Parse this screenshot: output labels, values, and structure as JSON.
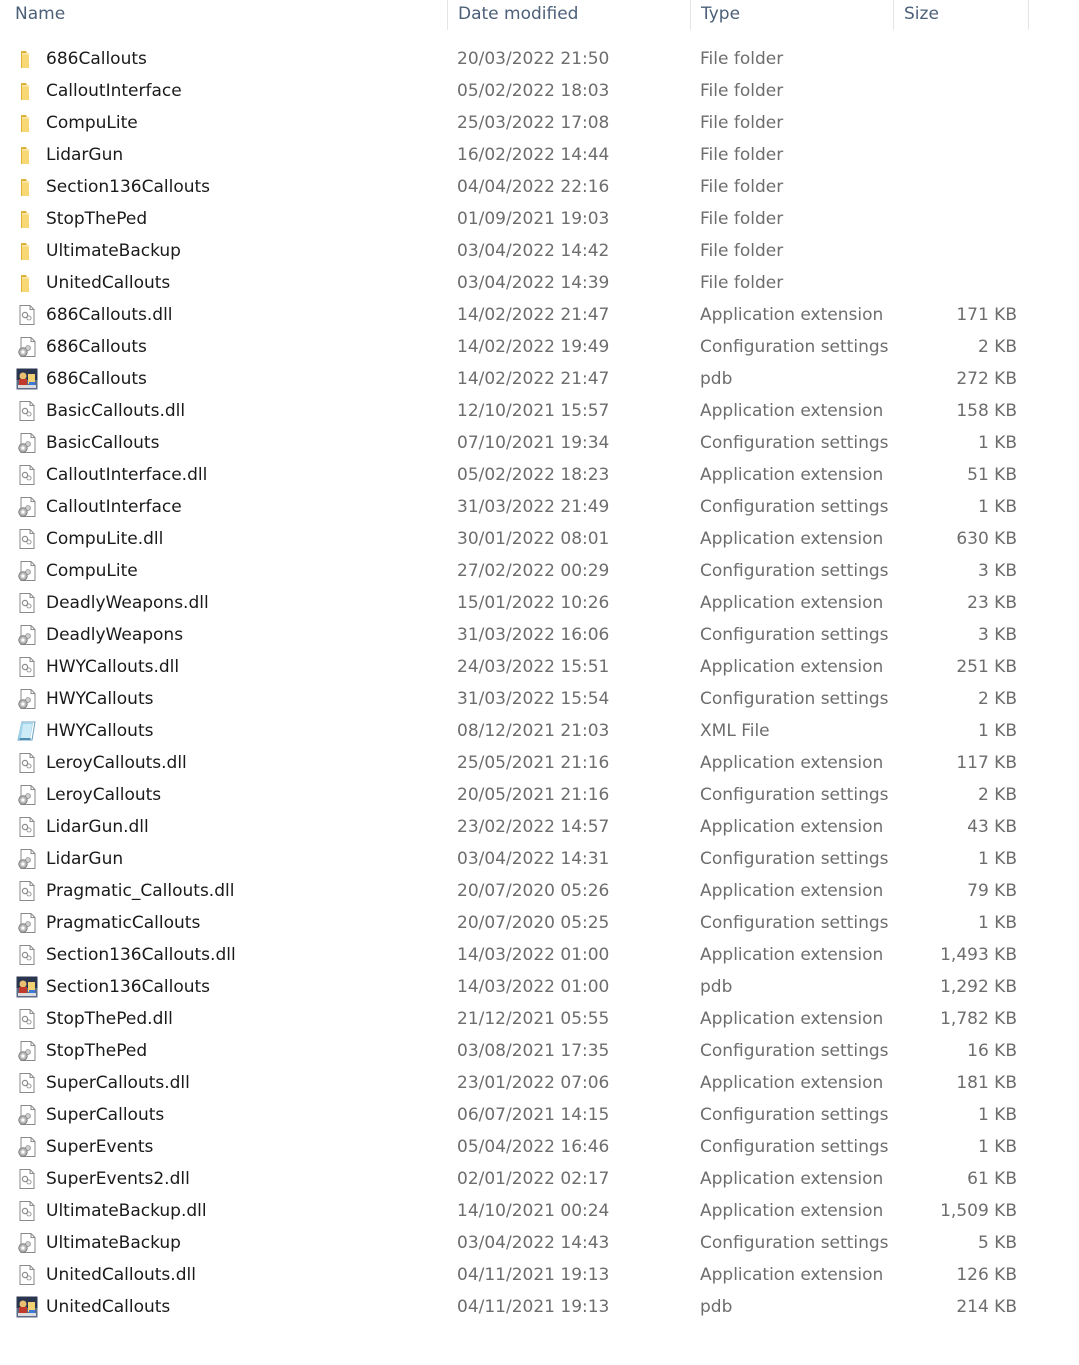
{
  "columns": {
    "name": "Name",
    "date": "Date modified",
    "type": "Type",
    "size": "Size"
  },
  "files": [
    {
      "name": "686Callouts",
      "date": "20/03/2022 21:50",
      "type": "File folder",
      "size": "",
      "icon": "folder-icon"
    },
    {
      "name": "CalloutInterface",
      "date": "05/02/2022 18:03",
      "type": "File folder",
      "size": "",
      "icon": "folder-icon"
    },
    {
      "name": "CompuLite",
      "date": "25/03/2022 17:08",
      "type": "File folder",
      "size": "",
      "icon": "folder-icon"
    },
    {
      "name": "LidarGun",
      "date": "16/02/2022 14:44",
      "type": "File folder",
      "size": "",
      "icon": "folder-icon"
    },
    {
      "name": "Section136Callouts",
      "date": "04/04/2022 22:16",
      "type": "File folder",
      "size": "",
      "icon": "folder-icon"
    },
    {
      "name": "StopThePed",
      "date": "01/09/2021 19:03",
      "type": "File folder",
      "size": "",
      "icon": "folder-icon"
    },
    {
      "name": "UltimateBackup",
      "date": "03/04/2022 14:42",
      "type": "File folder",
      "size": "",
      "icon": "folder-icon"
    },
    {
      "name": "UnitedCallouts",
      "date": "03/04/2022 14:39",
      "type": "File folder",
      "size": "",
      "icon": "folder-icon"
    },
    {
      "name": "686Callouts.dll",
      "date": "14/02/2022 21:47",
      "type": "Application extension",
      "size": "171 KB",
      "icon": "dll-icon"
    },
    {
      "name": "686Callouts",
      "date": "14/02/2022 19:49",
      "type": "Configuration settings",
      "size": "2 KB",
      "icon": "config-icon"
    },
    {
      "name": "686Callouts",
      "date": "14/02/2022 21:47",
      "type": "pdb",
      "size": "272 KB",
      "icon": "pdb-icon"
    },
    {
      "name": "BasicCallouts.dll",
      "date": "12/10/2021 15:57",
      "type": "Application extension",
      "size": "158 KB",
      "icon": "dll-icon"
    },
    {
      "name": "BasicCallouts",
      "date": "07/10/2021 19:34",
      "type": "Configuration settings",
      "size": "1 KB",
      "icon": "config-icon"
    },
    {
      "name": "CalloutInterface.dll",
      "date": "05/02/2022 18:23",
      "type": "Application extension",
      "size": "51 KB",
      "icon": "dll-icon"
    },
    {
      "name": "CalloutInterface",
      "date": "31/03/2022 21:49",
      "type": "Configuration settings",
      "size": "1 KB",
      "icon": "config-icon"
    },
    {
      "name": "CompuLite.dll",
      "date": "30/01/2022 08:01",
      "type": "Application extension",
      "size": "630 KB",
      "icon": "dll-icon"
    },
    {
      "name": "CompuLite",
      "date": "27/02/2022 00:29",
      "type": "Configuration settings",
      "size": "3 KB",
      "icon": "config-icon"
    },
    {
      "name": "DeadlyWeapons.dll",
      "date": "15/01/2022 10:26",
      "type": "Application extension",
      "size": "23 KB",
      "icon": "dll-icon"
    },
    {
      "name": "DeadlyWeapons",
      "date": "31/03/2022 16:06",
      "type": "Configuration settings",
      "size": "3 KB",
      "icon": "config-icon"
    },
    {
      "name": "HWYCallouts.dll",
      "date": "24/03/2022 15:51",
      "type": "Application extension",
      "size": "251 KB",
      "icon": "dll-icon"
    },
    {
      "name": "HWYCallouts",
      "date": "31/03/2022 15:54",
      "type": "Configuration settings",
      "size": "2 KB",
      "icon": "config-icon"
    },
    {
      "name": "HWYCallouts",
      "date": "08/12/2021 21:03",
      "type": "XML File",
      "size": "1 KB",
      "icon": "xml-icon"
    },
    {
      "name": "LeroyCallouts.dll",
      "date": "25/05/2021 21:16",
      "type": "Application extension",
      "size": "117 KB",
      "icon": "dll-icon"
    },
    {
      "name": "LeroyCallouts",
      "date": "20/05/2021 21:16",
      "type": "Configuration settings",
      "size": "2 KB",
      "icon": "config-icon"
    },
    {
      "name": "LidarGun.dll",
      "date": "23/02/2022 14:57",
      "type": "Application extension",
      "size": "43 KB",
      "icon": "dll-icon"
    },
    {
      "name": "LidarGun",
      "date": "03/04/2022 14:31",
      "type": "Configuration settings",
      "size": "1 KB",
      "icon": "config-icon"
    },
    {
      "name": "Pragmatic_Callouts.dll",
      "date": "20/07/2020 05:26",
      "type": "Application extension",
      "size": "79 KB",
      "icon": "dll-icon"
    },
    {
      "name": "PragmaticCallouts",
      "date": "20/07/2020 05:25",
      "type": "Configuration settings",
      "size": "1 KB",
      "icon": "config-icon"
    },
    {
      "name": "Section136Callouts.dll",
      "date": "14/03/2022 01:00",
      "type": "Application extension",
      "size": "1,493 KB",
      "icon": "dll-icon"
    },
    {
      "name": "Section136Callouts",
      "date": "14/03/2022 01:00",
      "type": "pdb",
      "size": "1,292 KB",
      "icon": "pdb-icon"
    },
    {
      "name": "StopThePed.dll",
      "date": "21/12/2021 05:55",
      "type": "Application extension",
      "size": "1,782 KB",
      "icon": "dll-icon"
    },
    {
      "name": "StopThePed",
      "date": "03/08/2021 17:35",
      "type": "Configuration settings",
      "size": "16 KB",
      "icon": "config-icon"
    },
    {
      "name": "SuperCallouts.dll",
      "date": "23/01/2022 07:06",
      "type": "Application extension",
      "size": "181 KB",
      "icon": "dll-icon"
    },
    {
      "name": "SuperCallouts",
      "date": "06/07/2021 14:15",
      "type": "Configuration settings",
      "size": "1 KB",
      "icon": "config-icon"
    },
    {
      "name": "SuperEvents",
      "date": "05/04/2022 16:46",
      "type": "Configuration settings",
      "size": "1 KB",
      "icon": "config-icon"
    },
    {
      "name": "SuperEvents2.dll",
      "date": "02/01/2022 02:17",
      "type": "Application extension",
      "size": "61 KB",
      "icon": "dll-icon"
    },
    {
      "name": "UltimateBackup.dll",
      "date": "14/10/2021 00:24",
      "type": "Application extension",
      "size": "1,509 KB",
      "icon": "dll-icon"
    },
    {
      "name": "UltimateBackup",
      "date": "03/04/2022 14:43",
      "type": "Configuration settings",
      "size": "5 KB",
      "icon": "config-icon"
    },
    {
      "name": "UnitedCallouts.dll",
      "date": "04/11/2021 19:13",
      "type": "Application extension",
      "size": "126 KB",
      "icon": "dll-icon"
    },
    {
      "name": "UnitedCallouts",
      "date": "04/11/2021 19:13",
      "type": "pdb",
      "size": "214 KB",
      "icon": "pdb-icon"
    }
  ],
  "colors": {
    "header_text": "#4c607a",
    "name_text": "#1a1a1a",
    "meta_text": "#6d6d6d",
    "folder": "#f8d775",
    "folder_dark": "#e0b13d"
  }
}
